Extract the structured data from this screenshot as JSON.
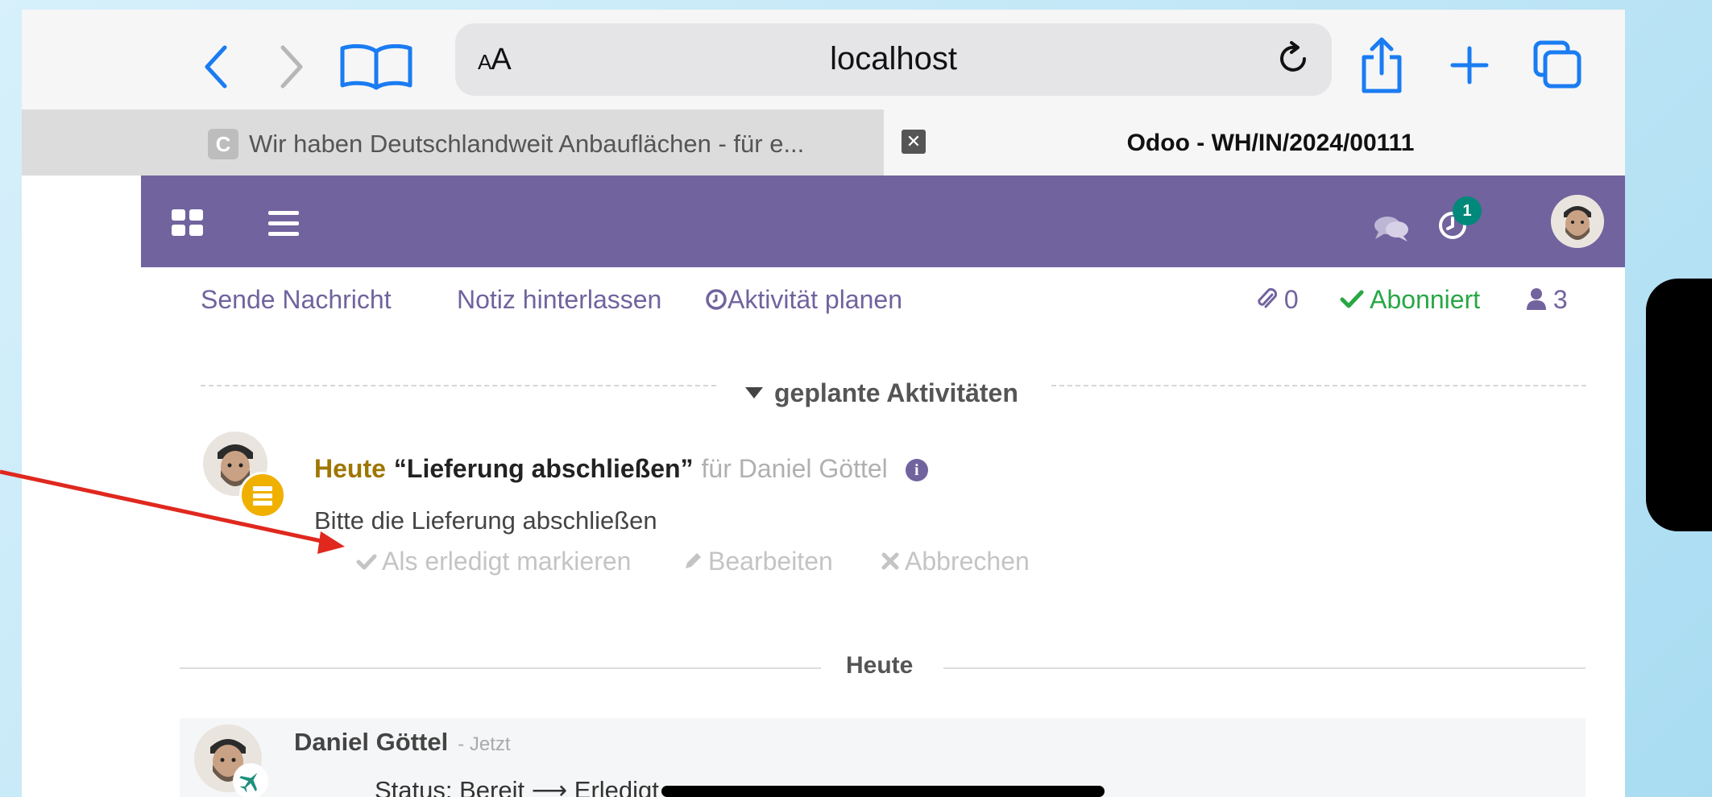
{
  "browser": {
    "text_size_label": "AA",
    "url": "localhost",
    "tabs": [
      {
        "favicon": "C",
        "title": "Wir haben Deutschlandweit Anbauflächen - für e..."
      },
      {
        "title": "Odoo - WH/IN/2024/00111"
      }
    ]
  },
  "navbar": {
    "activity_count": "1"
  },
  "chatter": {
    "send_message": "Sende Nachricht",
    "log_note": "Notiz hinterlassen",
    "schedule_activity": "Aktivität planen",
    "attachments_count": "0",
    "follow_state": "Abonniert",
    "followers_count": "3"
  },
  "activities": {
    "section_title": "geplante Aktivitäten",
    "items": [
      {
        "when": "Heute",
        "summary": "“Lieferung abschließen”",
        "assigned": "für Daniel Göttel",
        "note": "Bitte die Lieferung abschließen",
        "mark_done": "Als erledigt markieren",
        "edit": "Bearbeiten",
        "cancel": "Abbrechen"
      }
    ]
  },
  "messages": {
    "day_label": "Heute",
    "items": [
      {
        "author": "Daniel Göttel",
        "time": "- Jetzt",
        "track_prefix": "Status: Bereit",
        "track_arrow": "⟶",
        "track_new": "Erledigt"
      }
    ]
  },
  "colors": {
    "navbar": "#71639e",
    "follow": "#28a745",
    "activity_today": "#9e7600",
    "badge": "#00897b",
    "annotation_arrow": "#e0281e"
  }
}
